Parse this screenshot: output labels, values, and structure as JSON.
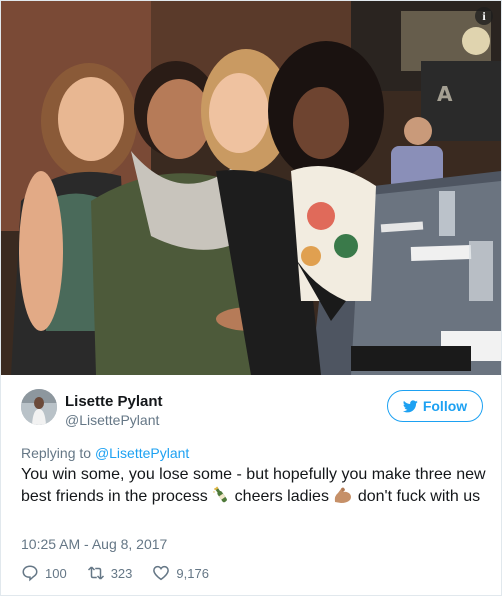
{
  "photo": {
    "info_icon_glyph": "i",
    "sign_text": "A"
  },
  "user": {
    "display_name": "Lisette Pylant",
    "handle": "@LisettePylant",
    "avatar_icon": "profile-photo"
  },
  "follow": {
    "label": "Follow",
    "icon": "twitter-bird-icon",
    "color": "#1da1f2"
  },
  "tweet": {
    "replying_prefix": "Replying to",
    "replying_to": "@LisettePylant",
    "text_part1": "You win some, you lose some - but hopefully you make three new best friends in the process",
    "text_part2": "cheers ladies",
    "text_part3": "don't fuck with us",
    "timestamp": "10:25 AM - Aug 8, 2017"
  },
  "stats": {
    "replies": "100",
    "retweets": "323",
    "likes": "9,176"
  },
  "colors": {
    "text_primary": "#14171a",
    "text_secondary": "#657786",
    "accent": "#1da1f2",
    "border": "#e1e8ed"
  }
}
